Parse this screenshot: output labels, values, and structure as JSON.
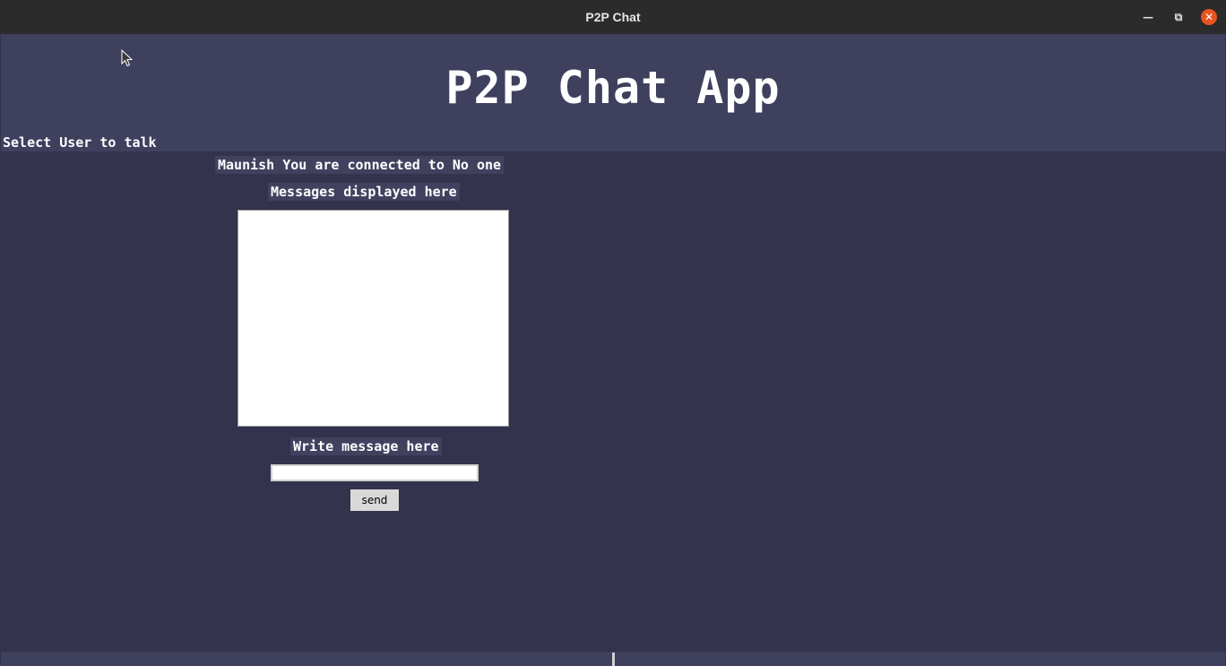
{
  "window": {
    "title": "P2P Chat",
    "controls": [
      "minimize-icon",
      "maximize-icon",
      "close-icon"
    ],
    "close_color": "#e95420"
  },
  "app": {
    "heading": "P2P Chat App",
    "select_user_label": "Select User to talk",
    "connection_status": "Maunish You are connected to No one",
    "messages_label": "Messages displayed here",
    "write_label": "Write message here",
    "message_input_value": "",
    "send_label": "send"
  },
  "colors": {
    "background": "#33334d",
    "header": "#3f3f5e",
    "text": "#ffffff"
  }
}
